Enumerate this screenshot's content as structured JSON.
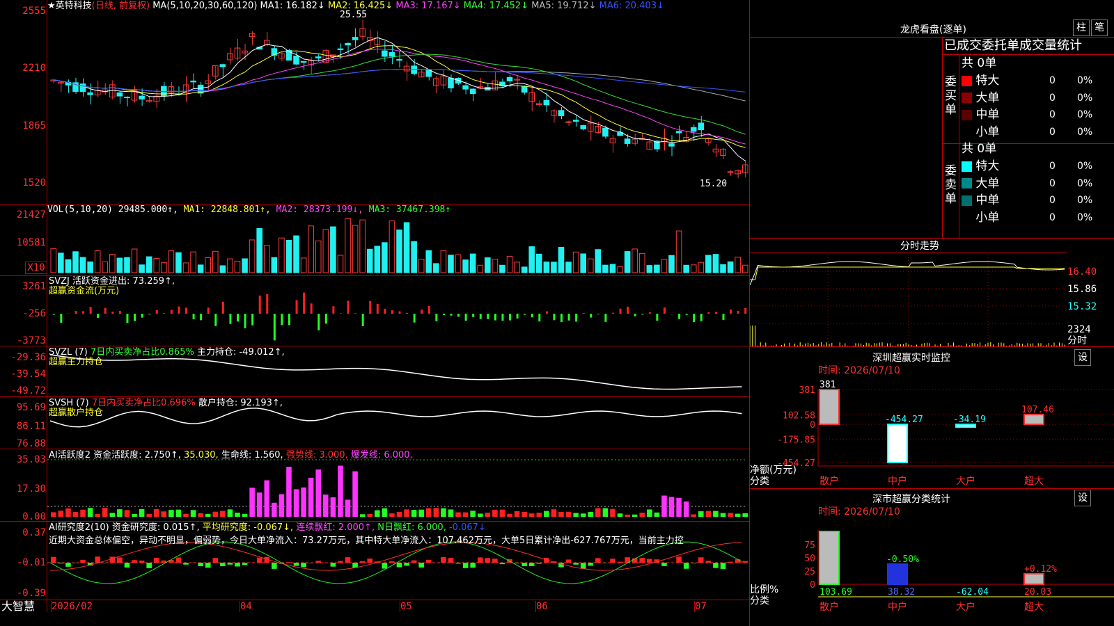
{
  "kline_legend": {
    "stock_name": "★英特科技",
    "period": "(日线, 前复权)",
    "ma_params": "MA(5,10,20,30,60,120)",
    "ma1": "MA1: 16.182↓",
    "ma2": "MA2: 16.425↓",
    "ma3": "MA3: 17.167↓",
    "ma4": "MA4: 17.452↓",
    "ma5": "MA5: 19.712↓",
    "ma6": "MA6: 20.403↓",
    "high_mark": "25.55",
    "low_mark": "15.20"
  },
  "kline_axis": [
    "2555",
    "2210",
    "1865",
    "1520"
  ],
  "vol_legend": {
    "name": "VOL(5,10,20)",
    "value": "29485.000↑,",
    "ma1": "MA1: 22848.801↑,",
    "ma2": "MA2: 28373.199↓,",
    "ma3": "MA3: 37467.398↑"
  },
  "vol_axis": [
    "21427",
    "10581",
    "X10"
  ],
  "svzj": {
    "line1a": "SVZJ  活跃资金进出: 73.259↑,",
    "line2": "超赢资金流(万元)",
    "axis": [
      "3261",
      "-256",
      "-3773"
    ]
  },
  "svzl": {
    "name": "SVZL (7)",
    "pct": "7日内买卖净占比0.865%",
    "hold": "主力持仓: -49.012↑,",
    "line2": "超赢主力持仓",
    "axis": [
      "-29.36",
      "-39.54",
      "-49.72"
    ]
  },
  "svsh": {
    "name": "SVSH (7)",
    "pct": "7日内买卖净占比0.696%",
    "hold": "散户持仓: 92.193↑,",
    "line2": "超赢散户持仓",
    "axis": [
      "95.69",
      "86.11",
      "76.88"
    ]
  },
  "ai_active": {
    "name": "AI活跃度2",
    "v1": "资金活跃度: 2.750↑,",
    "v2": "35.030,",
    "v3": "生命线: 1.560,",
    "v4": "强势线: 3.000,",
    "v5": "爆发线: 6.000,",
    "axis": [
      "35.03",
      "17.30",
      "0.00"
    ]
  },
  "ai_research": {
    "name": "AI研究度2(10)",
    "v1": "资金研究度: 0.015↑,",
    "v2": "平均研究度: -0.067↓,",
    "v3": "连续飘红: 2.000↑,",
    "v4": "N日飘红: 6.000,",
    "v5": "-0.067↓",
    "comment": "近期大资金总体偏空，异动不明显，偏弱势，今日大单净流入：73.27万元，其中特大单净流入：107.462万元，大单5日累计净出-627.767万元，当前主力控",
    "axis": [
      "0.37",
      "-0.01",
      "-0.39"
    ]
  },
  "bottom_axis": {
    "logo": "大智慧",
    "labels": [
      "2026/02",
      "04",
      "05",
      "06",
      "07"
    ]
  },
  "dragon_tiger": {
    "title": "龙虎看盘(逐单)",
    "btn1": "柱",
    "btn2": "笔",
    "tabs": "已成交委托单成交量统计",
    "buy_label": "委买单",
    "sell_label": "委卖单",
    "buy_total": "共 0单",
    "sell_total": "共 0单",
    "rows": [
      {
        "name": "特大",
        "count": "0",
        "pct": "0%",
        "buy_color": "#ff0000",
        "sell_color": "#00ffff"
      },
      {
        "name": "大单",
        "count": "0",
        "pct": "0%",
        "buy_color": "#8b0000",
        "sell_color": "#008b8b"
      },
      {
        "name": "中单",
        "count": "0",
        "pct": "0%",
        "buy_color": "#5a0000",
        "sell_color": "#007070"
      },
      {
        "name": "小单",
        "count": "0",
        "pct": "0%",
        "buy_color": "#000000",
        "sell_color": "#000000"
      }
    ]
  },
  "intraday": {
    "title": "分时走势",
    "axis": [
      "16.40",
      "15.86",
      "15.32",
      "2324",
      "分时"
    ]
  },
  "monitor": {
    "title": "深圳超赢实时监控",
    "btn": "设",
    "time": "时间: 2026/07/10",
    "axis": [
      "381",
      "102.58",
      "0",
      "-175.85",
      "-454.27"
    ],
    "ylabel": "净额(万元)",
    "xlabel": "分类",
    "categories": [
      "散户",
      "中户",
      "大户",
      "超大"
    ],
    "values": [
      381,
      -454.27,
      -34.19,
      107.46
    ],
    "labels": [
      "381",
      "-454.27",
      "-34.19",
      "107.46"
    ]
  },
  "classify": {
    "title": "深市超赢分类统计",
    "btn": "设",
    "time": "时间: 2026/07/10",
    "axis": [
      "75",
      "50",
      "25",
      "0"
    ],
    "ylabel": "比例%",
    "xlabel": "分类",
    "categories": [
      "散户",
      "中户",
      "大户",
      "超大"
    ],
    "top_labels": [
      "",
      "-0.50%",
      "",
      "+0.12%"
    ],
    "values": [
      "103.69",
      "38.32",
      "-62.04",
      "20.03"
    ]
  },
  "chart_data": [
    {
      "type": "bar",
      "title": "深圳超赢实时监控",
      "ylabel": "净额(万元)",
      "xlabel": "分类",
      "categories": [
        "散户",
        "中户",
        "大户",
        "超大"
      ],
      "values": [
        381,
        -454.27,
        -34.19,
        107.46
      ],
      "ylim": [
        -454.27,
        381
      ]
    },
    {
      "type": "bar",
      "title": "深市超赢分类统计",
      "ylabel": "比例%",
      "xlabel": "分类",
      "categories": [
        "散户",
        "中户",
        "大户",
        "超大"
      ],
      "values": [
        103.69,
        38.32,
        -62.04,
        20.03
      ],
      "ylim": [
        0,
        100
      ]
    }
  ]
}
